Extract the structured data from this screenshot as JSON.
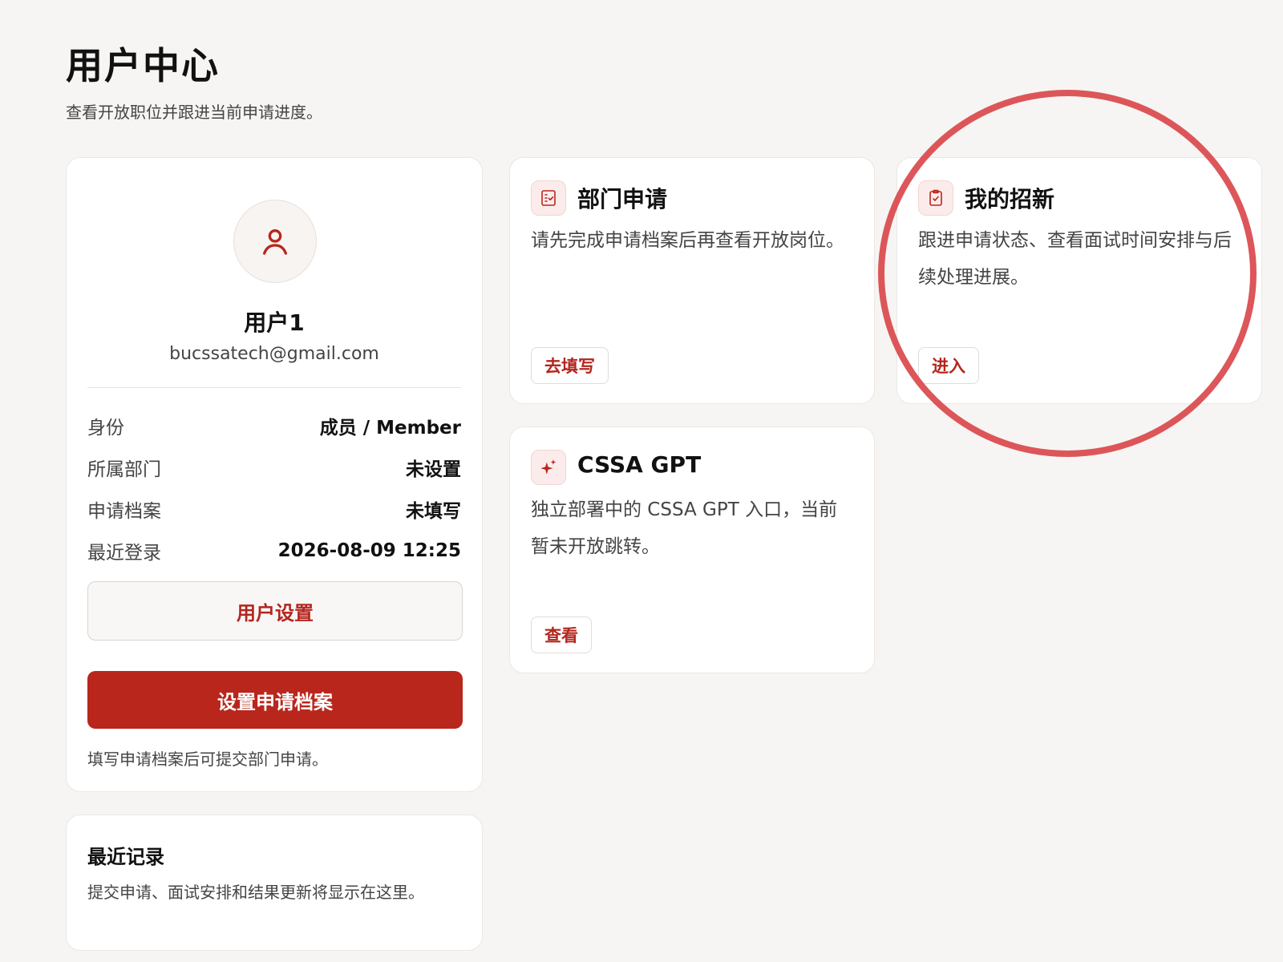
{
  "page": {
    "title": "用户中心",
    "subtitle": "查看开放职位并跟进当前申请进度。"
  },
  "profile": {
    "avatar_icon": "user-icon",
    "name": "用户1",
    "email": "bucssatech@gmail.com",
    "info": [
      {
        "label": "身份",
        "value": "成员 / Member"
      },
      {
        "label": "所属部门",
        "value": "未设置"
      },
      {
        "label": "申请档案",
        "value": "未填写"
      },
      {
        "label": "最近登录",
        "value": "2026-08-09 12:25"
      }
    ],
    "settings_button": "用户设置",
    "profile_button": "设置申请档案",
    "hint": "填写申请档案后可提交部门申请。"
  },
  "recent": {
    "title": "最近记录",
    "description": "提交申请、面试安排和结果更新将显示在这里。"
  },
  "cards": {
    "department": {
      "icon": "checklist-icon",
      "title": "部门申请",
      "description": "请先完成申请档案后再查看开放岗位。",
      "button": "去填写"
    },
    "recruitment": {
      "icon": "clipboard-check-icon",
      "title": "我的招新",
      "description": "跟进申请状态、查看面试时间安排与后续处理进展。",
      "button": "进入"
    },
    "gpt": {
      "icon": "sparkle-icon",
      "title": "CSSA GPT",
      "description": "独立部署中的 CSSA GPT 入口，当前暂未开放跳转。",
      "button": "查看"
    }
  },
  "colors": {
    "accent": "#b9261c",
    "highlight": "#d9484c",
    "background": "#f6f5f3"
  }
}
